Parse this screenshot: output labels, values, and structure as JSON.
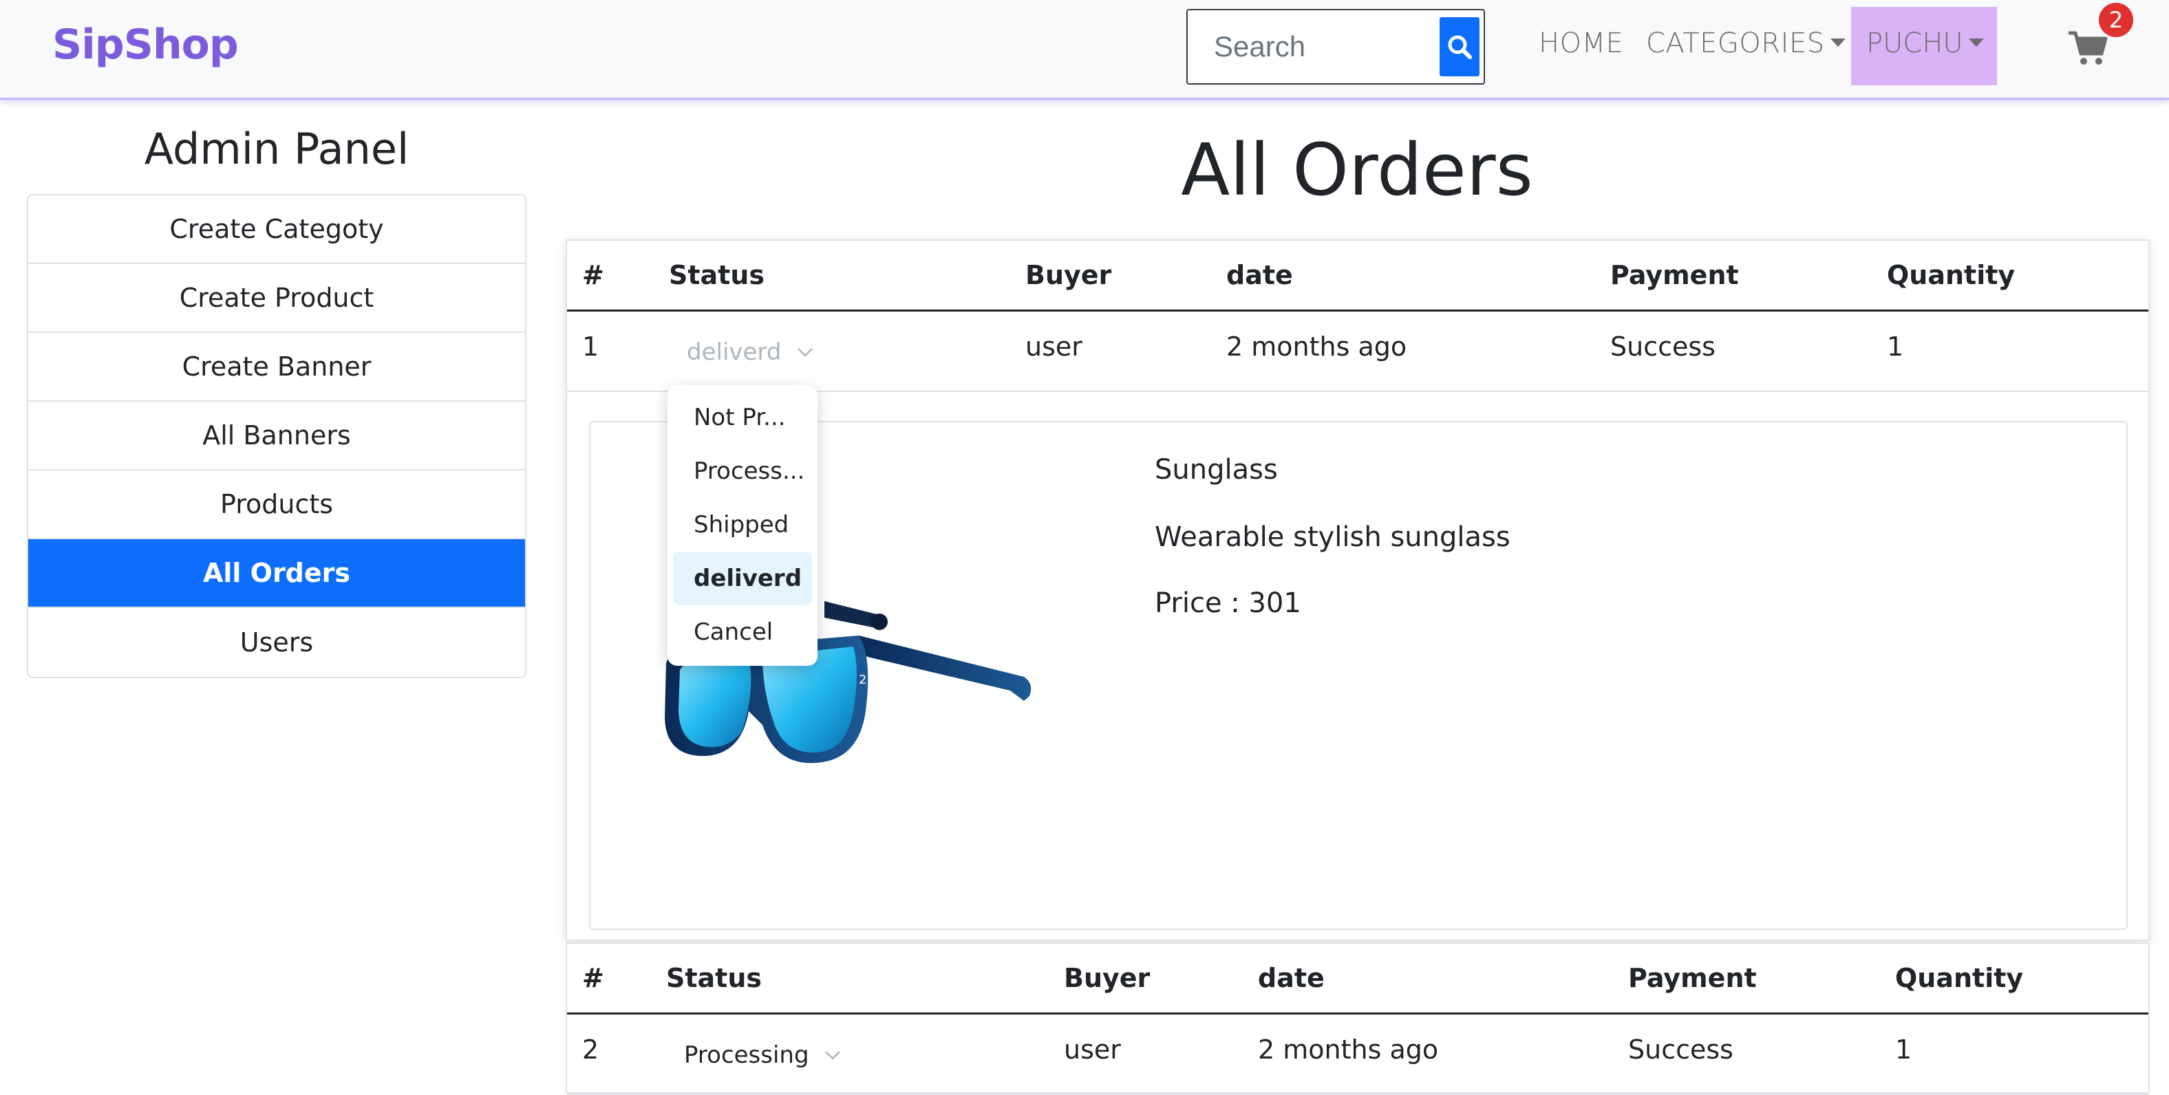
{
  "navbar": {
    "brand": "SipShop",
    "search": {
      "placeholder": "Search"
    },
    "links": {
      "home": "HOME",
      "categories": "CATEGORIES",
      "user": "PUCHU"
    },
    "cart_count": "2"
  },
  "sidebar": {
    "title": "Admin Panel",
    "items": [
      {
        "label": "Create Categoty"
      },
      {
        "label": "Create Product"
      },
      {
        "label": "Create Banner"
      },
      {
        "label": "All Banners"
      },
      {
        "label": "Products"
      },
      {
        "label": "All Orders",
        "active": true
      },
      {
        "label": "Users"
      }
    ]
  },
  "main": {
    "title": "All Orders",
    "columns": [
      "#",
      "Status",
      "Buyer",
      "date",
      "Payment",
      "Quantity"
    ],
    "orders": [
      {
        "index": "1",
        "status": "deliverd",
        "buyer": "user",
        "date": "2 months ago",
        "payment": "Success",
        "quantity": "1",
        "product": {
          "name": "Sunglass",
          "description": "Wearable stylish sunglass",
          "price": "Price : 301"
        }
      },
      {
        "index": "2",
        "status": "Processing",
        "buyer": "user",
        "date": "2 months ago",
        "payment": "Success",
        "quantity": "1"
      }
    ],
    "status_dropdown": {
      "options": [
        "Not Pr...",
        "Process...",
        "Shipped",
        "deliverd",
        "Cancel"
      ],
      "selected": "deliverd"
    }
  },
  "colors": {
    "brand": "#7c5cdc",
    "primary": "#0d6efd",
    "user_menu_bg": "#d9b3f5",
    "badge": "#e03131"
  }
}
